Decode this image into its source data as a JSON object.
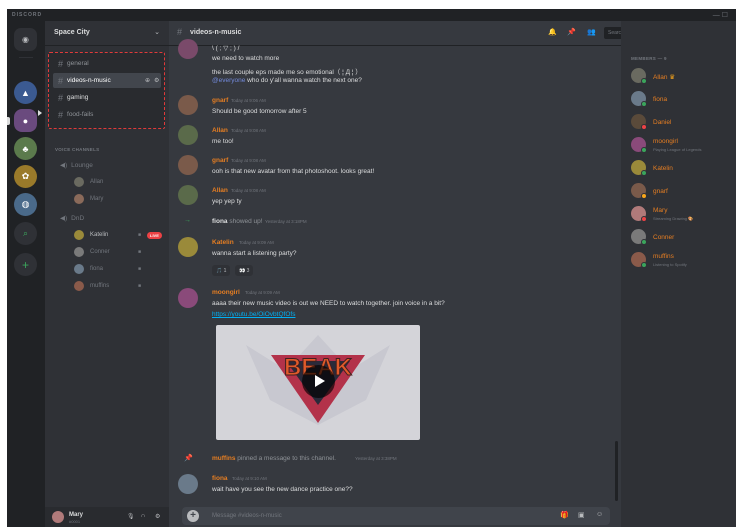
{
  "app": {
    "brand": "DISCORD",
    "window_controls": "— ☐"
  },
  "server": {
    "name": "Space City",
    "chevron": "⌄"
  },
  "text_channels": [
    {
      "name": "general"
    },
    {
      "name": "videos-n-music"
    },
    {
      "name": "gaming"
    },
    {
      "name": "food-fails"
    }
  ],
  "voice": {
    "category": "VOICE CHANNELS",
    "channels": [
      {
        "name": "Lounge",
        "users": [
          {
            "name": "Allan"
          },
          {
            "name": "Mary"
          }
        ]
      },
      {
        "name": "DnD",
        "users": [
          {
            "name": "Katelin",
            "live": "LIVE"
          },
          {
            "name": "Conner"
          },
          {
            "name": "fiona"
          },
          {
            "name": "muffins"
          }
        ]
      }
    ]
  },
  "user_panel": {
    "name": "Mary",
    "tag": "#0001"
  },
  "chat": {
    "channel": "videos-n-music",
    "search_placeholder": "Search",
    "lines_top": [
      "\\ (  ; ▽ ; ) /",
      "we need to watch more",
      "the last couple eps made me so emotional（ ¦ Д ¦ ）"
    ],
    "mention": "@everyone",
    "mention_rest": " who do y'all wanna watch the next one?",
    "messages": [
      {
        "user": "gnarf",
        "time": "Today at 9:06 AM",
        "text": "Should be good tomorrow after 5",
        "color": "#e67e22"
      },
      {
        "user": "Allan",
        "time": "Today at 9:08 AM",
        "text": "me too!",
        "color": "#e67e22"
      },
      {
        "user": "gnarf",
        "time": "Today at 9:08 AM",
        "text": "ooh is that new avatar from that photoshoot. looks great!",
        "color": "#e67e22"
      },
      {
        "user": "Allan",
        "time": "Today at 9:08 AM",
        "text": "yep yep ty",
        "color": "#e67e22"
      }
    ],
    "join": {
      "user": "fiona",
      "text": " showed up!",
      "time": "Yesterday at 3:18PM"
    },
    "katelin": {
      "user": "Katelin",
      "time": "Today at 9:09 AM",
      "text": "wanna start a listening party?",
      "color": "#e67e22",
      "reactions": [
        "🎵 1",
        "👀 3"
      ]
    },
    "moongirl": {
      "user": "moongirl",
      "time": "Today at 9:09 AM",
      "text": "aaaa their new music video is out we NEED to watch together. join voice in a bit?",
      "link": "https://youtu.be/OiOvbtQfOfs",
      "color": "#e67e22"
    },
    "pin": {
      "user": "muffins",
      "text": " pinned a message to this channel.",
      "time": "Yesterday at 3:38PM"
    },
    "fiona": {
      "user": "fiona",
      "time": "Today at 9:10 AM",
      "text": "wait have you see the new dance practice one??",
      "color": "#e67e22"
    },
    "composer_placeholder": "Message #videos-n-music",
    "embed_title": "BEAK"
  },
  "members": {
    "heading": "MEMBERS — 9",
    "list": [
      {
        "name": "Allan",
        "crown": "♛",
        "color": "#e67e22",
        "status": "online"
      },
      {
        "name": "fiona",
        "color": "#e67e22",
        "status": "online"
      },
      {
        "name": "Daniel",
        "color": "#e67e22",
        "status": "dnd"
      },
      {
        "name": "moongirl",
        "activity": "Playing League of Legends",
        "color": "#e67e22",
        "status": "online"
      },
      {
        "name": "Katelin",
        "color": "#e67e22",
        "status": "online"
      },
      {
        "name": "gnarf",
        "color": "#e67e22",
        "status": "idle"
      },
      {
        "name": "Mary",
        "activity": "Streaming Drawing 🎨",
        "color": "#e67e22",
        "status": "dnd"
      },
      {
        "name": "Conner",
        "color": "#e67e22",
        "status": "online"
      },
      {
        "name": "muffins",
        "activity": "Listening to Spotify",
        "color": "#e67e22",
        "status": "online"
      }
    ]
  },
  "colors": {
    "accent": "#7289da",
    "alert_box": "#e03a3a",
    "online": "#3ba55c"
  }
}
